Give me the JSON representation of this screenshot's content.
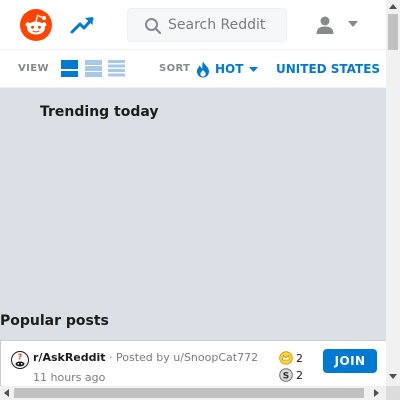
{
  "header": {
    "logo_icon": "reddit-snoo-icon",
    "trending_icon": "trending-up-icon",
    "search": {
      "placeholder": "Search Reddit",
      "value": ""
    },
    "user_icon": "user-icon",
    "menu_icon": "chevron-down-icon"
  },
  "toolbar": {
    "view_label": "VIEW",
    "view_modes": [
      {
        "icon": "card-view-icon",
        "selected": true
      },
      {
        "icon": "classic-view-icon",
        "selected": false
      },
      {
        "icon": "compact-view-icon",
        "selected": false
      }
    ],
    "sort_label": "SORT",
    "sort_value": "HOT",
    "region_value": "UNITED STATES"
  },
  "main": {
    "trending_title": "Trending today",
    "popular_title": "Popular posts",
    "posts": [
      {
        "subreddit": "r/AskReddit",
        "posted_by": "· Posted by u/SnoopCat772",
        "time": "11 hours ago",
        "awards": [
          {
            "icon": "gold-award-icon",
            "count": "2"
          },
          {
            "icon": "silver-award-icon",
            "count": "2"
          }
        ],
        "join_label": "JOIN"
      }
    ]
  },
  "colors": {
    "brand": "#ff4500",
    "accent": "#0079d3",
    "page_bg": "#dae0e6"
  }
}
